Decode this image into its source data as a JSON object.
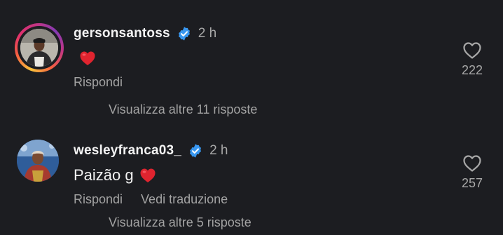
{
  "comments": [
    {
      "username": "gersonsantoss",
      "time": "2 h",
      "text": "",
      "actions": {
        "reply": "Rispondi"
      },
      "likes": "222",
      "view_replies": "Visualizza altre 11 risposte"
    },
    {
      "username": "wesleyfranca03_",
      "time": "2 h",
      "text": "Paizão g",
      "actions": {
        "reply": "Rispondi",
        "translate": "Vedi traduzione"
      },
      "likes": "257",
      "view_replies": "Visualizza altre 5 risposte"
    }
  ],
  "icons": {
    "verified": "verified-badge-icon",
    "emoji": "red-heart-emoji-icon",
    "like": "heart-outline-icon"
  },
  "colors": {
    "background": "#1c1d21",
    "verified": "#3897f0",
    "emoji_heart": "#e0242f",
    "secondary_text": "#a8a8a8"
  }
}
